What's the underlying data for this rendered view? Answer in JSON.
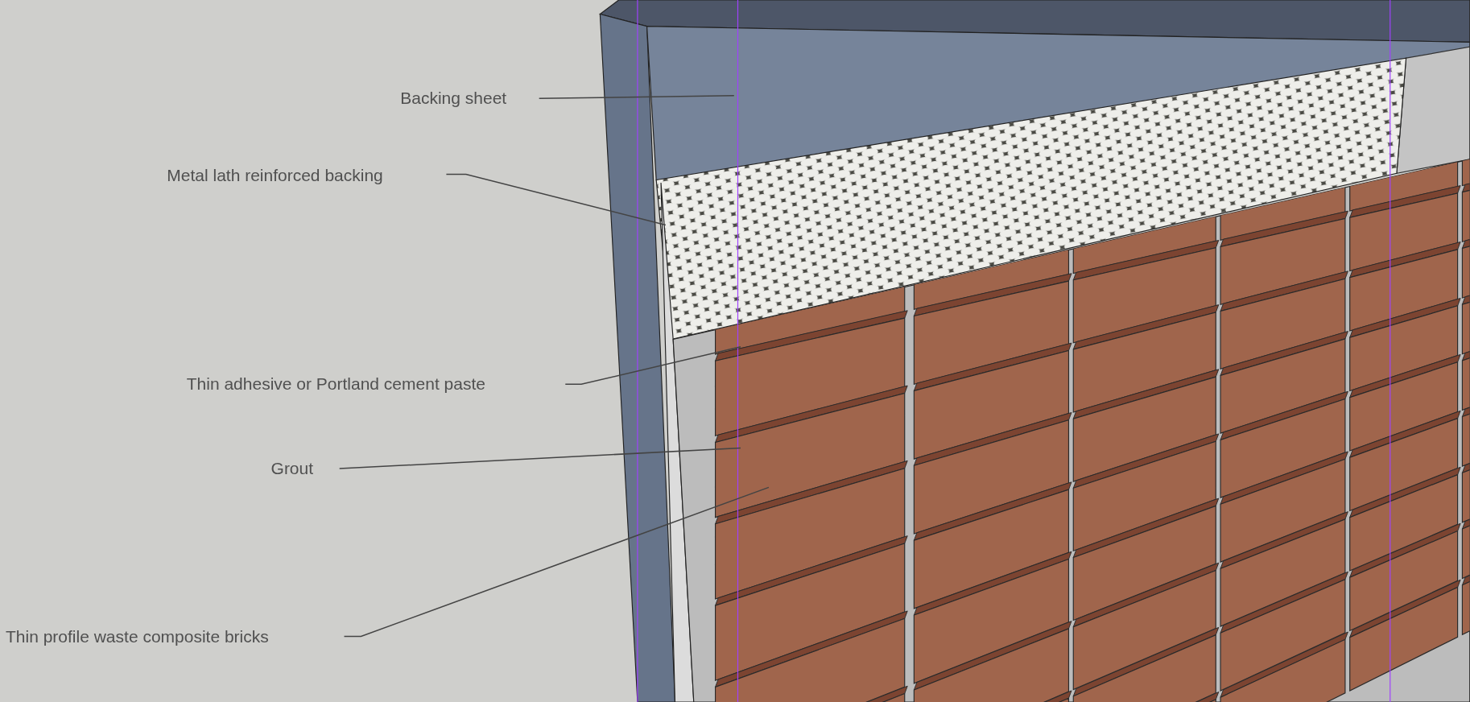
{
  "viewport": {
    "callouts": [
      {
        "text": "Backing sheet"
      },
      {
        "text": "Metal lath reinforced backing"
      },
      {
        "text": "Thin adhesive or Portland cement paste"
      },
      {
        "text": "Grout"
      },
      {
        "text": "Thin profile waste composite bricks"
      }
    ]
  }
}
